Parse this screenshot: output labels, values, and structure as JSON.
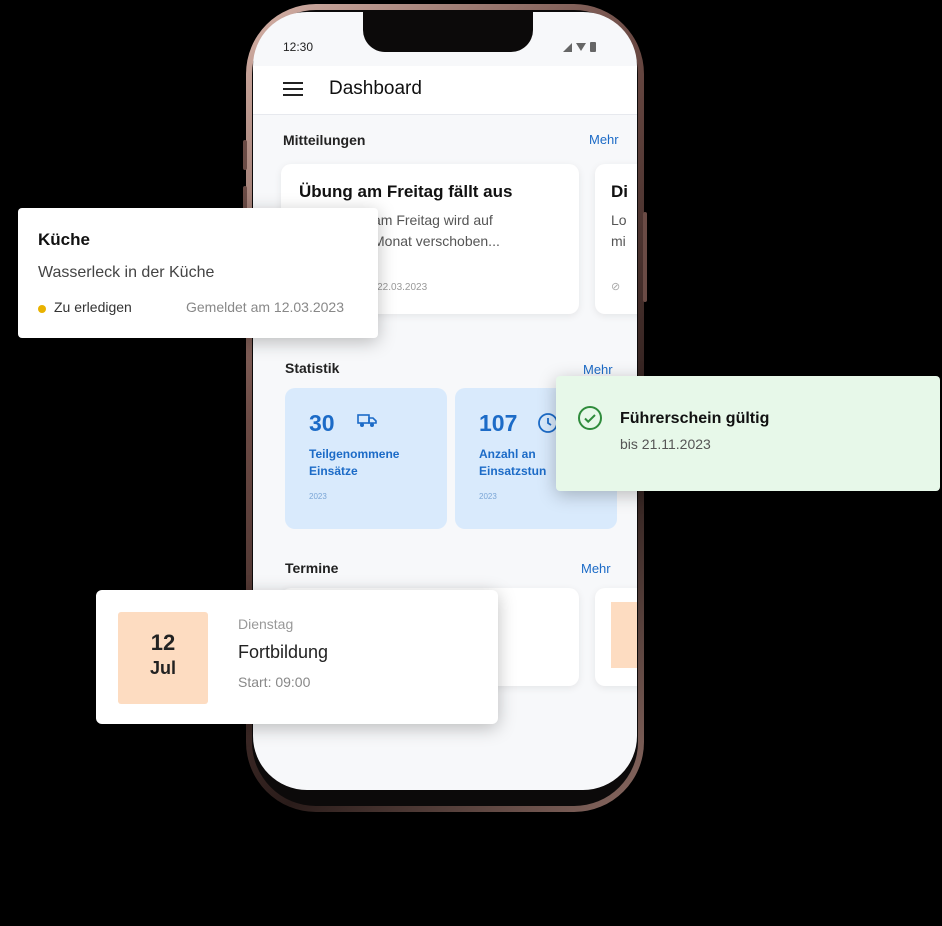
{
  "status_bar": {
    "time": "12:30"
  },
  "app_bar": {
    "title": "Dashboard"
  },
  "announcements": {
    "section_title": "Mitteilungen",
    "more_label": "Mehr",
    "cards": [
      {
        "title": "Übung am Freitag fällt aus",
        "body_line1": "am Freitag wird auf",
        "body_line2": "Monat verschoben...",
        "meta": "· 22.03.2023"
      },
      {
        "title": "Di",
        "body_line1": "Lo",
        "body_line2": "mi"
      }
    ]
  },
  "statistics": {
    "section_title": "Statistik",
    "more_label": "Mehr",
    "cards": [
      {
        "value": "30",
        "label_line1": "Teilgenommene",
        "label_line2": "Einsätze",
        "year": "2023",
        "icon": "truck-icon"
      },
      {
        "value": "107",
        "label_line1": "Anzahl an",
        "label_line2": "Einsatzstun",
        "year": "2023",
        "icon": "clock-icon"
      }
    ]
  },
  "appointments": {
    "section_title": "Termine",
    "more_label": "Mehr"
  },
  "task_card": {
    "title": "Küche",
    "description": "Wasserleck in der Küche",
    "status": "Zu erledigen",
    "reported": "Gemeldet am 12.03.2023",
    "status_color": "#e9b200"
  },
  "license_card": {
    "title": "Führerschein gültig",
    "subtitle": "bis 21.11.2023",
    "icon": "check-circle-icon",
    "accent": "#2f8c3c"
  },
  "event_card": {
    "day": "12",
    "month": "Jul",
    "weekday": "Dienstag",
    "title": "Fortbildung",
    "start": "Start: 09:00"
  },
  "colors": {
    "accent": "#1c6bc7",
    "stat_bg": "#d9eafc",
    "event_date_bg": "#fddcc1"
  }
}
